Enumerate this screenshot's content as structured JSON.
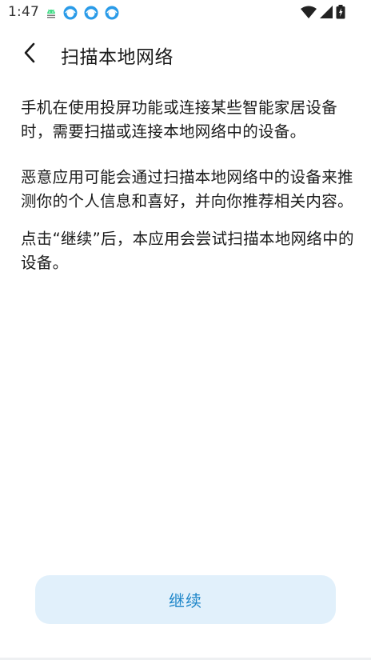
{
  "status_bar": {
    "time": "1:47",
    "notification_icons": [
      "android-debug-icon",
      "app-notification-icon",
      "app-notification-icon",
      "app-notification-icon"
    ],
    "system_icons": [
      "wifi-icon",
      "cell-signal-icon",
      "battery-icon"
    ]
  },
  "app_bar": {
    "back_icon": "chevron-left-icon",
    "title": "扫描本地网络"
  },
  "content": {
    "paragraph_1": "手机在使用投屏功能或连接某些智能家居设备时，需要扫描或连接本地网络中的设备。",
    "paragraph_2": "恶意应用可能会通过扫描本地网络中的设备来推测你的个人信息和喜好，并向你推荐相关内容。",
    "paragraph_3": "点击“继续”后，本应用会尝试扫描本地网络中的设备。"
  },
  "actions": {
    "continue_label": "继续"
  },
  "colors": {
    "accent": "#1e86c9",
    "button_bg": "#e1f0fb",
    "text": "#1a1a1a",
    "background": "#ffffff"
  }
}
